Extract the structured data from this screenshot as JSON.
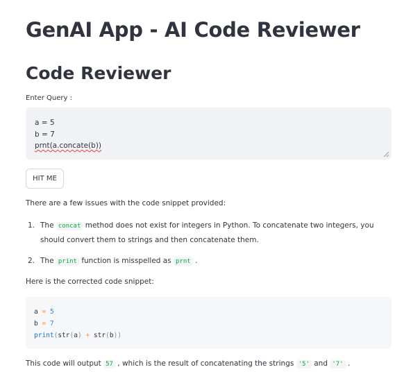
{
  "app": {
    "title": "GenAI App - AI Code Reviewer"
  },
  "section": {
    "title": "Code Reviewer"
  },
  "query": {
    "label": "Enter Query :",
    "lines": [
      "a = 5",
      "b = 7",
      "prnt(a.concate(b))"
    ]
  },
  "button": {
    "label": "HIT ME"
  },
  "response": {
    "intro": "There are a few issues with the code snippet provided:",
    "issues": [
      {
        "number": "1.",
        "before": "The",
        "code": "concat",
        "after": "method does not exist for integers in Python. To concatenate two integers, you should convert them to strings and then concatenate them."
      },
      {
        "number": "2.",
        "before": "The",
        "code": "print",
        "middle": "function is misspelled as",
        "code2": "prnt",
        "after": "."
      }
    ],
    "corrected_label": "Here is the corrected code snippet:",
    "code_block": {
      "line1": {
        "name": "a",
        "op": "=",
        "num": "5"
      },
      "line2": {
        "name": "b",
        "op": "=",
        "num": "7"
      },
      "line3": {
        "fn": "print",
        "p1": "(",
        "str1": "str",
        "p2": "(",
        "arg1": "a",
        "p3": ")",
        "op": "+",
        "str2": "str",
        "p4": "(",
        "arg2": "b",
        "p5": "))"
      }
    },
    "output": {
      "before": "This code will output",
      "code1": "57",
      "middle": ", which is the result of concatenating the strings",
      "code2": "'5'",
      "and": "and",
      "code3": "'7'",
      "end": "."
    }
  },
  "colors": {
    "text": "#31333f",
    "input_bg": "#f0f2f6",
    "inline_code": "#09ab3b",
    "spell_error": "#e23b3b"
  }
}
